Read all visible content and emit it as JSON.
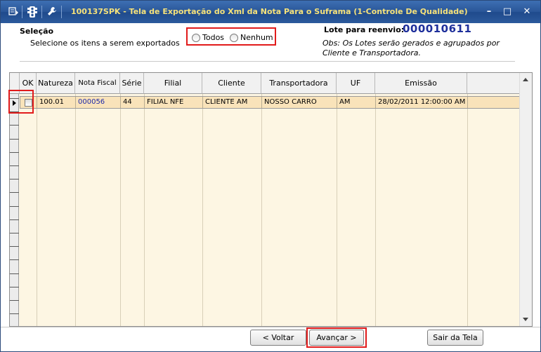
{
  "window": {
    "title": "100137SPK - Tela de Exportação do Xml da Nota Para o Suframa (1-Controle De Qualidade)",
    "minimize": "–",
    "maximize": "□",
    "close": "✕",
    "icons": [
      "menu-icon",
      "traffic-light-icon",
      "wrench-icon"
    ]
  },
  "selection": {
    "title": "Seleção",
    "subtitle": "Selecione os itens a serem exportados",
    "options": [
      {
        "label": "Todos",
        "selected": false
      },
      {
        "label": "Nenhum",
        "selected": false
      }
    ]
  },
  "lote": {
    "label": "Lote para reenvio:",
    "value": "000010611",
    "obs": "Obs: Os Lotes serão gerados e agrupados por Cliente e Transportadora."
  },
  "grid": {
    "columns": [
      "OK",
      "Natureza",
      "Nota Fiscal",
      "Série",
      "Filial",
      "Cliente",
      "Transportadora",
      "UF",
      "Emissão"
    ],
    "rows": [
      {
        "ok": false,
        "natureza": "100.01",
        "nota_fiscal": "000056",
        "serie": "44",
        "filial": "FILIAL NFE",
        "cliente": "CLIENTE AM",
        "transportadora": "NOSSO CARRO",
        "uf": "AM",
        "emissao": "28/02/2011 12:00:00 AM"
      }
    ]
  },
  "buttons": {
    "voltar": "< Voltar",
    "avancar": "Avançar >",
    "sair": "Sair da Tela"
  },
  "colors": {
    "title_text": "#f6e27a",
    "title_bar": "#2a5698",
    "lote_value": "#1e2f9b",
    "highlight": "#e11b1b",
    "grid_bg": "#fdf6e3",
    "selected_row": "#f9e3ba"
  }
}
